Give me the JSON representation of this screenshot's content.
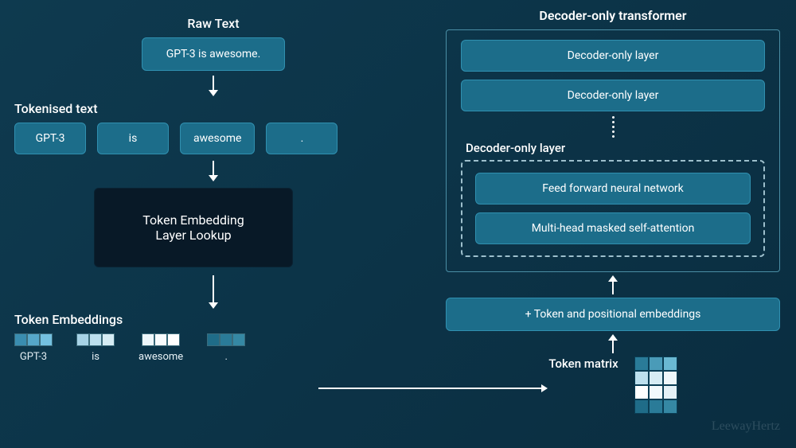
{
  "left": {
    "raw_text_label": "Raw Text",
    "raw_text_value": "GPT-3 is awesome.",
    "tokenised_label": "Tokenised text",
    "tokens": [
      "GPT-3",
      "is",
      "awesome",
      "."
    ],
    "embedding_box_line1": "Token Embedding",
    "embedding_box_line2": "Layer Lookup",
    "token_embeddings_label": "Token Embeddings",
    "embedding_tokens": [
      "GPT-3",
      "is",
      "awesome",
      "."
    ],
    "embedding_colors": [
      [
        "#3a8db0",
        "#56a7c9",
        "#74c1e0"
      ],
      [
        "#a7d3e6",
        "#bde0ee",
        "#d6ecf4"
      ],
      [
        "#eef7fb",
        "#f8fcfe",
        "#ffffff"
      ],
      [
        "#1f6c88",
        "#2a7b98",
        "#3588a4"
      ]
    ]
  },
  "right": {
    "decoder_title": "Decoder-only transformer",
    "layer1": "Decoder-only layer",
    "layer2": "Decoder-only layer",
    "inner_title": "Decoder-only layer",
    "ffn": "Feed forward neural network",
    "mha": "Multi-head masked self-attention",
    "embed_box": "+ Token and positional embeddings",
    "matrix_label": "Token matrix",
    "matrix_colors": [
      [
        "#2a7b98",
        "#4a9bb8",
        "#6ab8d2"
      ],
      [
        "#bde0ee",
        "#d6ecf4",
        "#eef7fb"
      ],
      [
        "#ffffff",
        "#f2f9fc",
        "#e4f1f7"
      ],
      [
        "#1f6c88",
        "#2a7b98",
        "#3588a4"
      ]
    ]
  },
  "watermark": "LeewayHertz"
}
